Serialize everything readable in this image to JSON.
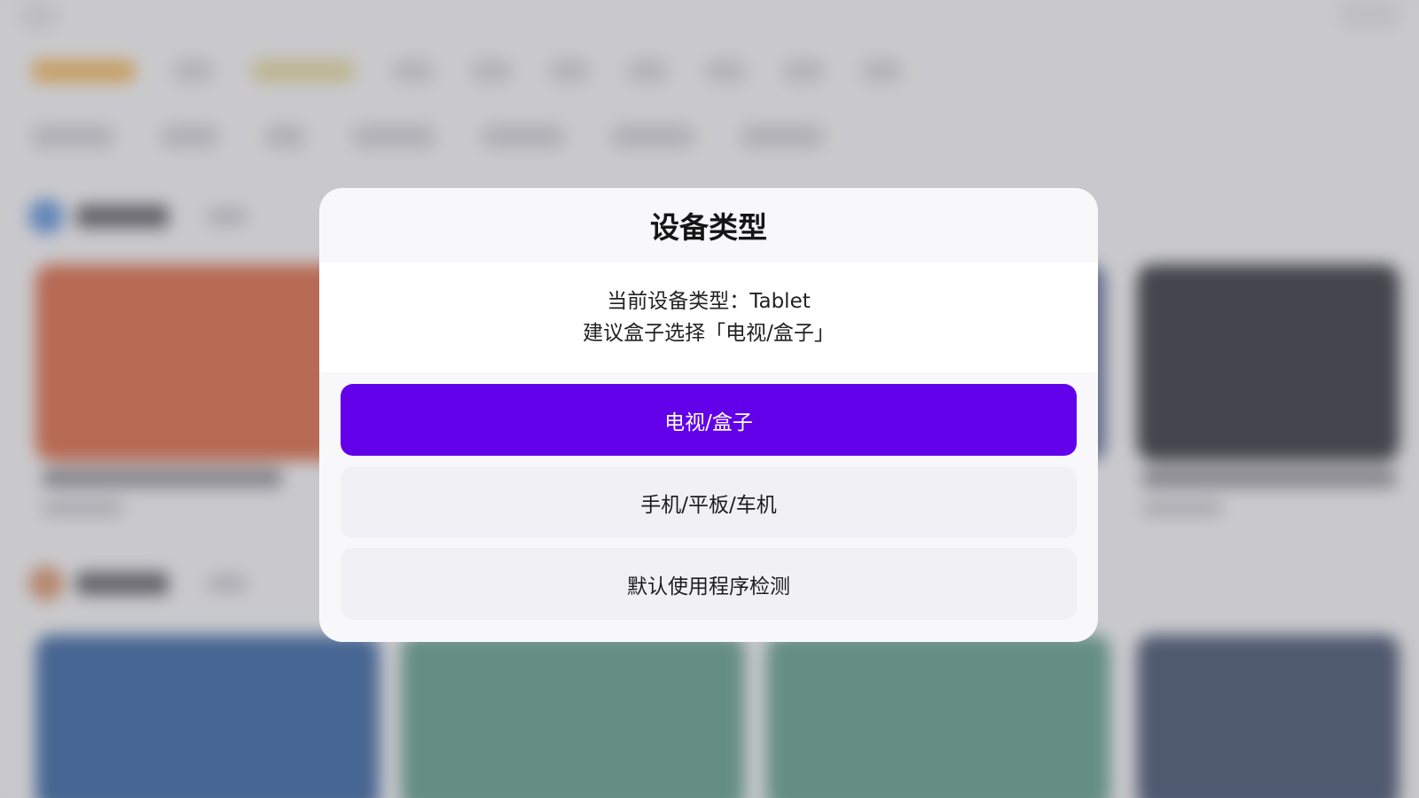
{
  "dialog": {
    "title": "设备类型",
    "message_line1": "当前设备类型：Tablet",
    "message_line2": "建议盒子选择「电视/盒子」",
    "options": [
      {
        "label": "电视/盒子",
        "selected": true
      },
      {
        "label": "手机/平板/车机",
        "selected": false
      },
      {
        "label": "默认使用程序检测",
        "selected": false
      }
    ]
  },
  "colors": {
    "primary": "#6200ea",
    "dialog_bg": "#f8f8fa",
    "option_bg": "#f1f1f5",
    "overlay": "#8a8a8f"
  }
}
